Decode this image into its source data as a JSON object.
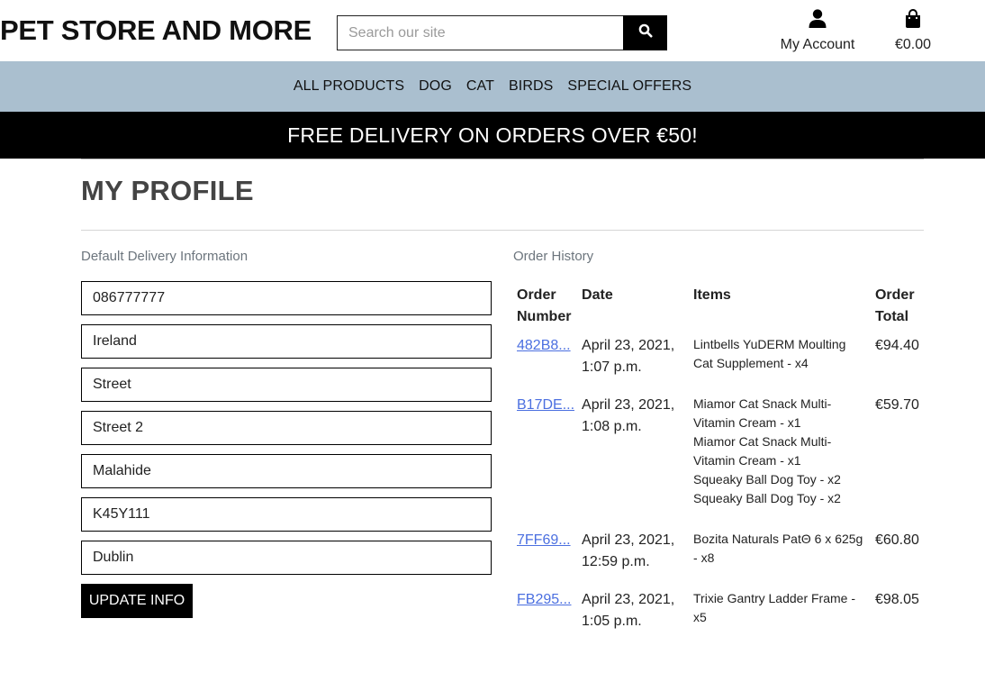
{
  "header": {
    "logo": "PET STORE AND MORE",
    "search_placeholder": "Search our site",
    "account_label": "My Account",
    "bag_total": "€0.00"
  },
  "nav": {
    "items": [
      "ALL PRODUCTS",
      "DOG",
      "CAT",
      "BIRDS",
      "SPECIAL OFFERS"
    ]
  },
  "banner": {
    "text": "FREE DELIVERY ON ORDERS OVER €50!"
  },
  "page": {
    "title": "MY PROFILE"
  },
  "delivery": {
    "label": "Default Delivery Information",
    "fields": [
      "086777777",
      "Ireland",
      "Street",
      "Street 2",
      "Malahide",
      "K45Y111",
      "Dublin"
    ],
    "update_button": "UPDATE INFO"
  },
  "orders": {
    "label": "Order History",
    "headers": {
      "number": "Order Number",
      "date": "Date",
      "items": "Items",
      "total": "Order Total"
    },
    "rows": [
      {
        "number": "482B8...",
        "date": "April 23, 2021, 1:07 p.m.",
        "items": [
          "Lintbells YuDERM Moulting Cat Supplement - x4"
        ],
        "total": "€94.40"
      },
      {
        "number": "B17DE...",
        "date": "April 23, 2021, 1:08 p.m.",
        "items": [
          "Miamor Cat Snack Multi-Vitamin Cream - x1",
          "Miamor Cat Snack Multi-Vitamin Cream - x1",
          "Squeaky Ball Dog Toy - x2",
          "Squeaky Ball Dog Toy - x2"
        ],
        "total": "€59.70"
      },
      {
        "number": "7FF69...",
        "date": "April 23, 2021, 12:59 p.m.",
        "items": [
          "Bozita Naturals PatΘ 6 x 625g - x8"
        ],
        "total": "€60.80"
      },
      {
        "number": "FB295...",
        "date": "April 23, 2021, 1:05 p.m.",
        "items": [
          "Trixie Gantry Ladder Frame - x5"
        ],
        "total": "€98.05"
      }
    ]
  },
  "icons": {
    "search": "search-icon",
    "account": "user-icon",
    "bag": "shopping-bag-icon"
  },
  "colors": {
    "nav_bg": "#aabfcf",
    "banner_bg": "#000000",
    "link": "#4b6fe0"
  }
}
